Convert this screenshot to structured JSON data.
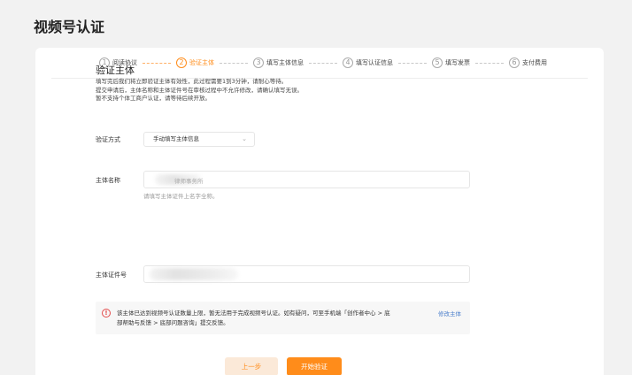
{
  "page": {
    "title": "视频号认证"
  },
  "steps": [
    {
      "num": "1",
      "label": "阅读协议",
      "active": false
    },
    {
      "num": "2",
      "label": "验证主体",
      "active": true
    },
    {
      "num": "3",
      "label": "填写主体信息",
      "active": false
    },
    {
      "num": "4",
      "label": "填写认证信息",
      "active": false
    },
    {
      "num": "5",
      "label": "填写发票",
      "active": false
    },
    {
      "num": "6",
      "label": "支付费用",
      "active": false
    }
  ],
  "section": {
    "title": "验证主体",
    "desc": [
      "填写完后我们将立即验证主体有效性，此过程需要1到3分钟，请耐心等待。",
      "提交申请后，主体名称和主体证件号在审核过程中不允许修改，请确认填写无误。",
      "暂不支持个体工商户认证，请等待后续开放。"
    ]
  },
  "form": {
    "method_label": "验证方式",
    "method_value": "手动填写主体信息",
    "name_label": "主体名称",
    "name_value_suffix": "律师事务所",
    "name_hint": "请填写主体证件上名字全称。",
    "id_label": "主体证件号"
  },
  "notice": {
    "lines": [
      "该主体已达到视频号认证数量上限，暂无法用于完成视频号认证。如有疑问，可至手机端「创作者中心 > 底",
      "部帮助与反馈 > 底部问题咨询」提交反馈。"
    ],
    "link": "修改主体"
  },
  "buttons": {
    "prev": "上一步",
    "start": "开始验证"
  },
  "colors": {
    "accent": "#ff8c1a",
    "link": "#4a7ecb",
    "error": "#e34b4b"
  }
}
